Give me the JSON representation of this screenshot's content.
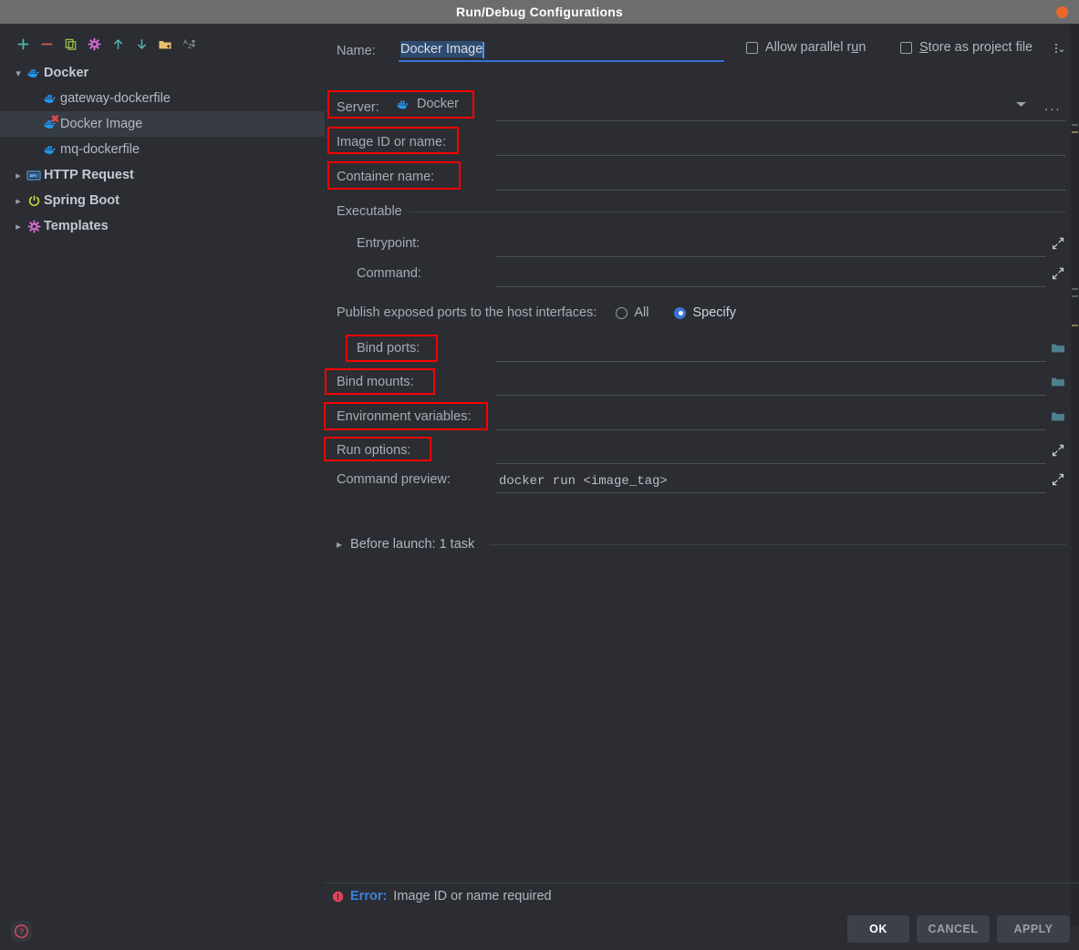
{
  "window": {
    "title": "Run/Debug Configurations",
    "close_icon": "close-circle-icon"
  },
  "sidebar": {
    "toolbar": [
      {
        "name": "add-configuration-button",
        "icon": "plus-icon",
        "color": "#4db6ac"
      },
      {
        "name": "remove-configuration-button",
        "icon": "minus-icon",
        "color": "#cf5b56"
      },
      {
        "name": "copy-configuration-button",
        "icon": "copy-icon",
        "color": "#9fc44b"
      },
      {
        "name": "edit-templates-button",
        "icon": "gear-icon",
        "color": "#d46fd4"
      },
      {
        "name": "move-up-button",
        "icon": "arrow-up-icon",
        "color": "#4db6ac"
      },
      {
        "name": "move-down-button",
        "icon": "arrow-down-icon",
        "color": "#4db6ac"
      },
      {
        "name": "new-folder-button",
        "icon": "folder-add-icon",
        "color": "#e8c170"
      },
      {
        "name": "sort-alphabetically-button",
        "icon": "sort-az-icon",
        "color": "#9aa0a8"
      }
    ],
    "tree": [
      {
        "label": "Docker",
        "type": "group",
        "expanded": true,
        "icon": "docker-icon",
        "selected": false
      },
      {
        "label": "gateway-dockerfile",
        "type": "child",
        "icon": "docker-icon",
        "selected": false,
        "error": false
      },
      {
        "label": "Docker Image",
        "type": "child",
        "icon": "docker-icon",
        "selected": true,
        "error": true
      },
      {
        "label": "mq-dockerfile",
        "type": "child",
        "icon": "docker-icon",
        "selected": false,
        "error": false
      },
      {
        "label": "HTTP Request",
        "type": "group",
        "expanded": false,
        "icon": "http-request-icon",
        "selected": false
      },
      {
        "label": "Spring Boot",
        "type": "group",
        "expanded": false,
        "icon": "spring-boot-icon",
        "selected": false
      },
      {
        "label": "Templates",
        "type": "group",
        "expanded": false,
        "icon": "gear-icon",
        "selected": false
      }
    ],
    "help_icon": "help-question-icon"
  },
  "form": {
    "name_label": "Name:",
    "name_value": "Docker Image",
    "allow_parallel_run_label_pre": "Allow parallel r",
    "allow_parallel_run_mnemonic": "u",
    "allow_parallel_run_label_post": "n",
    "allow_parallel_run_checked": false,
    "store_as_project_file_mnemonic": "S",
    "store_as_project_file_label_post": "tore as project file",
    "store_as_project_file_checked": false,
    "options_menu_icon": "more-options-icon",
    "server_label": "Server:",
    "server_value": "Docker",
    "server_dropdown_icon": "chevron-down-icon",
    "server_browse_label": "...",
    "image_id_label": "Image ID or name:",
    "image_id_value": "",
    "container_name_label": "Container name:",
    "container_name_value": "",
    "executable_section": "Executable",
    "entrypoint_label": "Entrypoint:",
    "entrypoint_value": "",
    "command_label": "Command:",
    "command_value": "",
    "publish_ports_label": "Publish exposed ports to the host interfaces:",
    "radio_all_label": "All",
    "radio_specify_label": "Specify",
    "radio_selected": "Specify",
    "bind_ports_label": "Bind ports:",
    "bind_ports_value": "",
    "bind_mounts_label": "Bind mounts:",
    "bind_mounts_value": "",
    "environment_variables_label": "Environment variables:",
    "environment_variables_value": "",
    "run_options_label": "Run options:",
    "run_options_value": "",
    "command_preview_label": "Command preview:",
    "command_preview_value": "docker run <image_tag>",
    "before_launch_label": "Before launch: 1 task",
    "before_launch_expanded": false,
    "expand_icon": "expand-field-icon",
    "browse_folder_icon": "folder-browse-icon"
  },
  "footer": {
    "error_icon": "error-octagon-icon",
    "error_label": "Error:",
    "error_message": "Image ID or name required",
    "ok_label": "OK",
    "cancel_label": "CANCEL",
    "apply_label": "APPLY"
  },
  "colors": {
    "accent_blue": "#3574d4",
    "error_red": "#e0484a",
    "annotation_red": "#ff0000",
    "titlebar_gray": "#6d6d6d",
    "background": "#2b2d33"
  }
}
